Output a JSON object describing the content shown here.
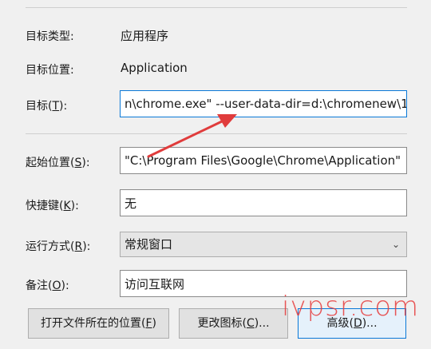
{
  "fields": {
    "type": {
      "label": "目标类型:",
      "value": "应用程序"
    },
    "location": {
      "label": "目标位置:",
      "value": "Application"
    },
    "target": {
      "label_prefix": "目标(",
      "label_key": "T",
      "label_suffix": "):",
      "value": "n\\chrome.exe\" --user-data-dir=d:\\chromenew\\1"
    },
    "start_in": {
      "label_prefix": "起始位置(",
      "label_key": "S",
      "label_suffix": "):",
      "value": "\"C:\\Program Files\\Google\\Chrome\\Application\""
    },
    "shortcut_key": {
      "label_prefix": "快捷键(",
      "label_key": "K",
      "label_suffix": "):",
      "value": "无"
    },
    "run": {
      "label_prefix": "运行方式(",
      "label_key": "R",
      "label_suffix": "):",
      "value": "常规窗口"
    },
    "comment": {
      "label_prefix": "备注(",
      "label_key": "O",
      "label_suffix": "):",
      "value": "访问互联网"
    }
  },
  "buttons": {
    "open_location": {
      "prefix": "打开文件所在的位置(",
      "key": "F",
      "suffix": ")"
    },
    "change_icon": {
      "prefix": "更改图标(",
      "key": "C",
      "suffix": ")..."
    },
    "advanced": {
      "prefix": "高级(",
      "key": "D",
      "suffix": ")..."
    }
  },
  "watermark": "ivpsr.com",
  "colors": {
    "focus_border": "#0a78d7",
    "annotation_arrow": "#e03c3c"
  }
}
